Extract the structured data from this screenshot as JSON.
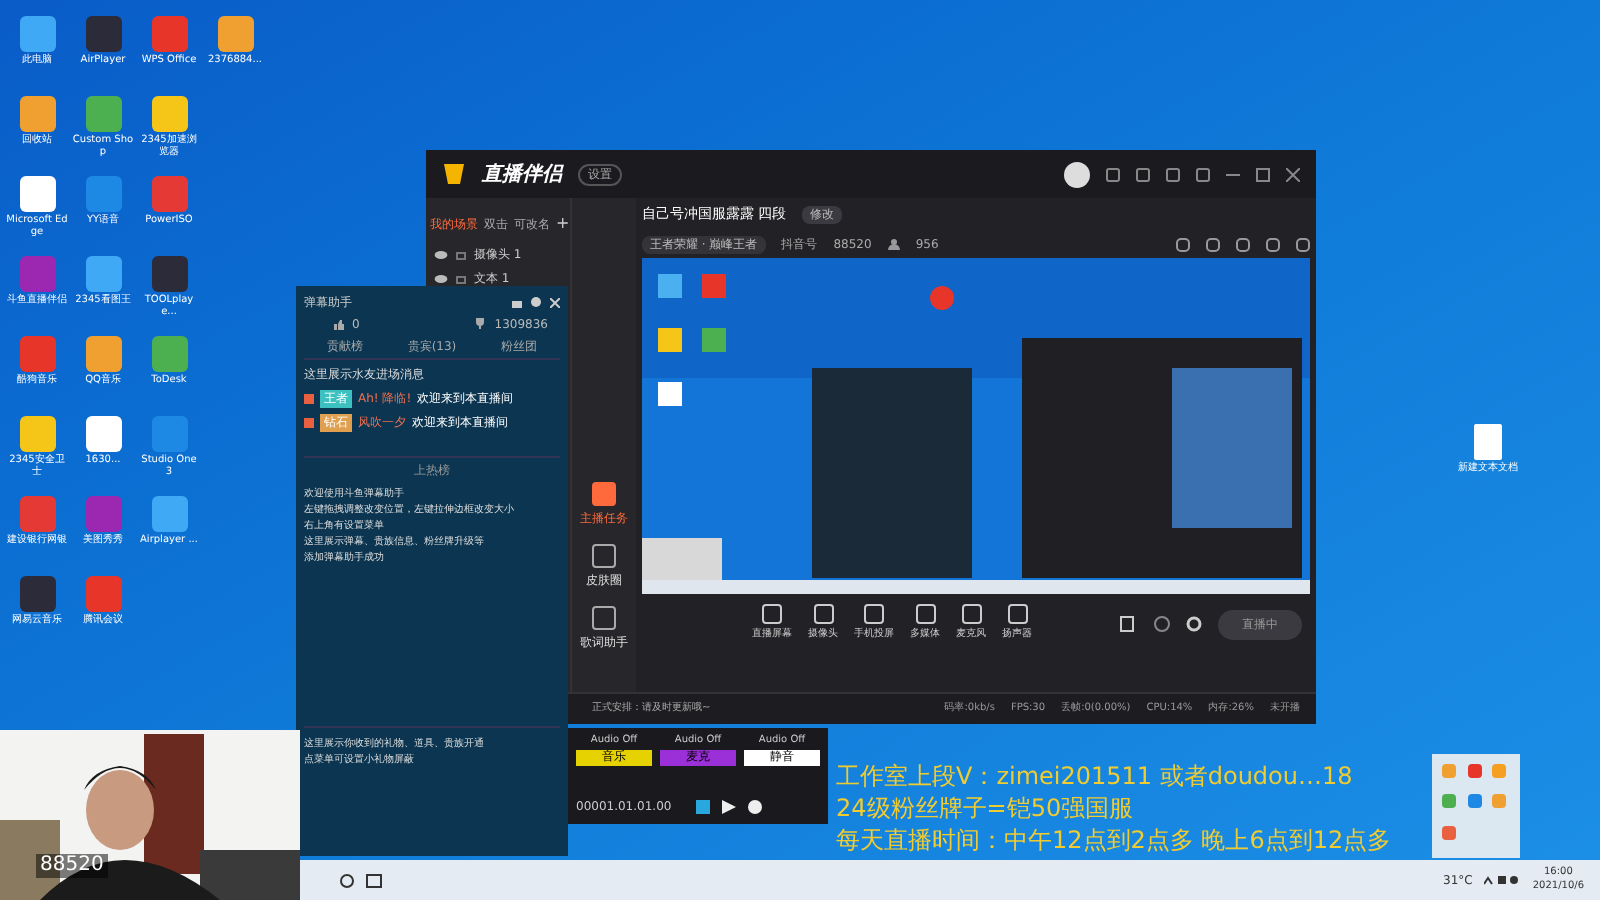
{
  "desktop_icons": [
    [
      {
        "label": "此电脑"
      },
      {
        "label": "AirPlayer"
      },
      {
        "label": "WPS Office"
      },
      {
        "label": "2376884..."
      }
    ],
    [
      {
        "label": "回收站"
      },
      {
        "label": "Custom Shop"
      },
      {
        "label": "2345加速浏览器"
      }
    ],
    [
      {
        "label": "Microsoft Edge"
      },
      {
        "label": "YY语音"
      },
      {
        "label": "PowerISO"
      }
    ],
    [
      {
        "label": "斗鱼直播伴侣"
      },
      {
        "label": "2345看图王"
      },
      {
        "label": "TOOLplaye..."
      }
    ],
    [
      {
        "label": "酷狗音乐"
      },
      {
        "label": "QQ音乐"
      },
      {
        "label": "ToDesk"
      }
    ],
    [
      {
        "label": "2345安全卫士"
      },
      {
        "label": "1630..."
      },
      {
        "label": "Studio One 3"
      }
    ],
    [
      {
        "label": "建设银行网银"
      },
      {
        "label": "美图秀秀"
      },
      {
        "label": "Airplayer ..."
      }
    ],
    [
      {
        "label": "网易云音乐"
      },
      {
        "label": "腾讯会议"
      }
    ]
  ],
  "desktop_icon_right": {
    "label": "新建文本文档"
  },
  "app": {
    "logo": "直播伴侣",
    "badge": "设置",
    "scene_tabs": [
      {
        "label": "我的场景",
        "selected": true
      },
      {
        "label": "双击",
        "selected": false
      },
      {
        "label": "可改名",
        "selected": false
      }
    ],
    "add_tab": "+",
    "sources": [
      {
        "label": "摄像头 1",
        "visible": true
      },
      {
        "label": "文本 1",
        "visible": true
      }
    ],
    "tools": [
      {
        "label": "主播任务",
        "selected": true
      },
      {
        "label": "皮肤圈",
        "selected": false
      },
      {
        "label": "歌词助手",
        "selected": false
      }
    ],
    "stream_title": "自己号冲国服露露 四段",
    "edit_button": "修改",
    "category": "王者荣耀 · 巅峰王者",
    "account_label": "抖音号",
    "account_id": "88520",
    "viewers": "956",
    "toolbar": [
      {
        "label": "直播屏幕"
      },
      {
        "label": "摄像头"
      },
      {
        "label": "手机投屏"
      },
      {
        "label": "多媒体"
      },
      {
        "label": "麦克风"
      },
      {
        "label": "扬声器"
      }
    ],
    "live_button": "直播中",
    "notice": "正式安排：请及时更新哦~",
    "stats": [
      "码率:0kb/s",
      "FPS:30",
      "丢帧:0(0.00%)",
      "CPU:14%",
      "内存:26%",
      "未开播"
    ]
  },
  "danmu": {
    "title": "弹幕助手",
    "likes": "0",
    "score": "1309836",
    "tabs": [
      {
        "label": "贡献榜",
        "selected": false
      },
      {
        "label": "贵宾(13)",
        "selected": false
      },
      {
        "label": "粉丝团",
        "selected": false
      }
    ],
    "enter_hint": "这里展示水友进场消息",
    "entries": [
      {
        "badge": "王者",
        "color": "#3cc0c0",
        "user": "Ah! 降临!",
        "message": "欢迎来到本直播间"
      },
      {
        "badge": "钻石",
        "color": "#e0a050",
        "user": "风吹一夕",
        "message": "欢迎来到本直播间"
      }
    ],
    "section": "上热榜",
    "intro": [
      "欢迎使用斗鱼弹幕助手",
      "左键拖拽调整改变位置，左键拉伸边框改变大小",
      "右上角有设置菜单",
      "这里展示弹幕、贵族信息、粉丝牌升级等",
      "添加弹幕助手成功"
    ],
    "gift_hint": [
      "这里展示你收到的礼物、道具、贵族开通",
      "点菜单可设置小礼物屏蔽"
    ]
  },
  "mixer": {
    "channels": [
      {
        "label": "音乐",
        "status": "Audio Off",
        "color": "#e6d200"
      },
      {
        "label": "麦克",
        "status": "Audio Off",
        "color": "#9b30d9"
      },
      {
        "label": "静音",
        "status": "Audio Off",
        "color": "#ffffff"
      }
    ],
    "time": "00001.01.01.00"
  },
  "overlay_text": [
    "工作室上段V：zimei201511 或者doudou…18",
    "24级粉丝牌子=铠50强国服",
    "每天直播时间：中午12点到2点多 晚上6点到12点多"
  ],
  "webcam": {
    "kind": "picture",
    "caption": "88520"
  },
  "taskbar": {
    "weather": "31°C",
    "time": "16:00",
    "date": "2021/10/6"
  }
}
